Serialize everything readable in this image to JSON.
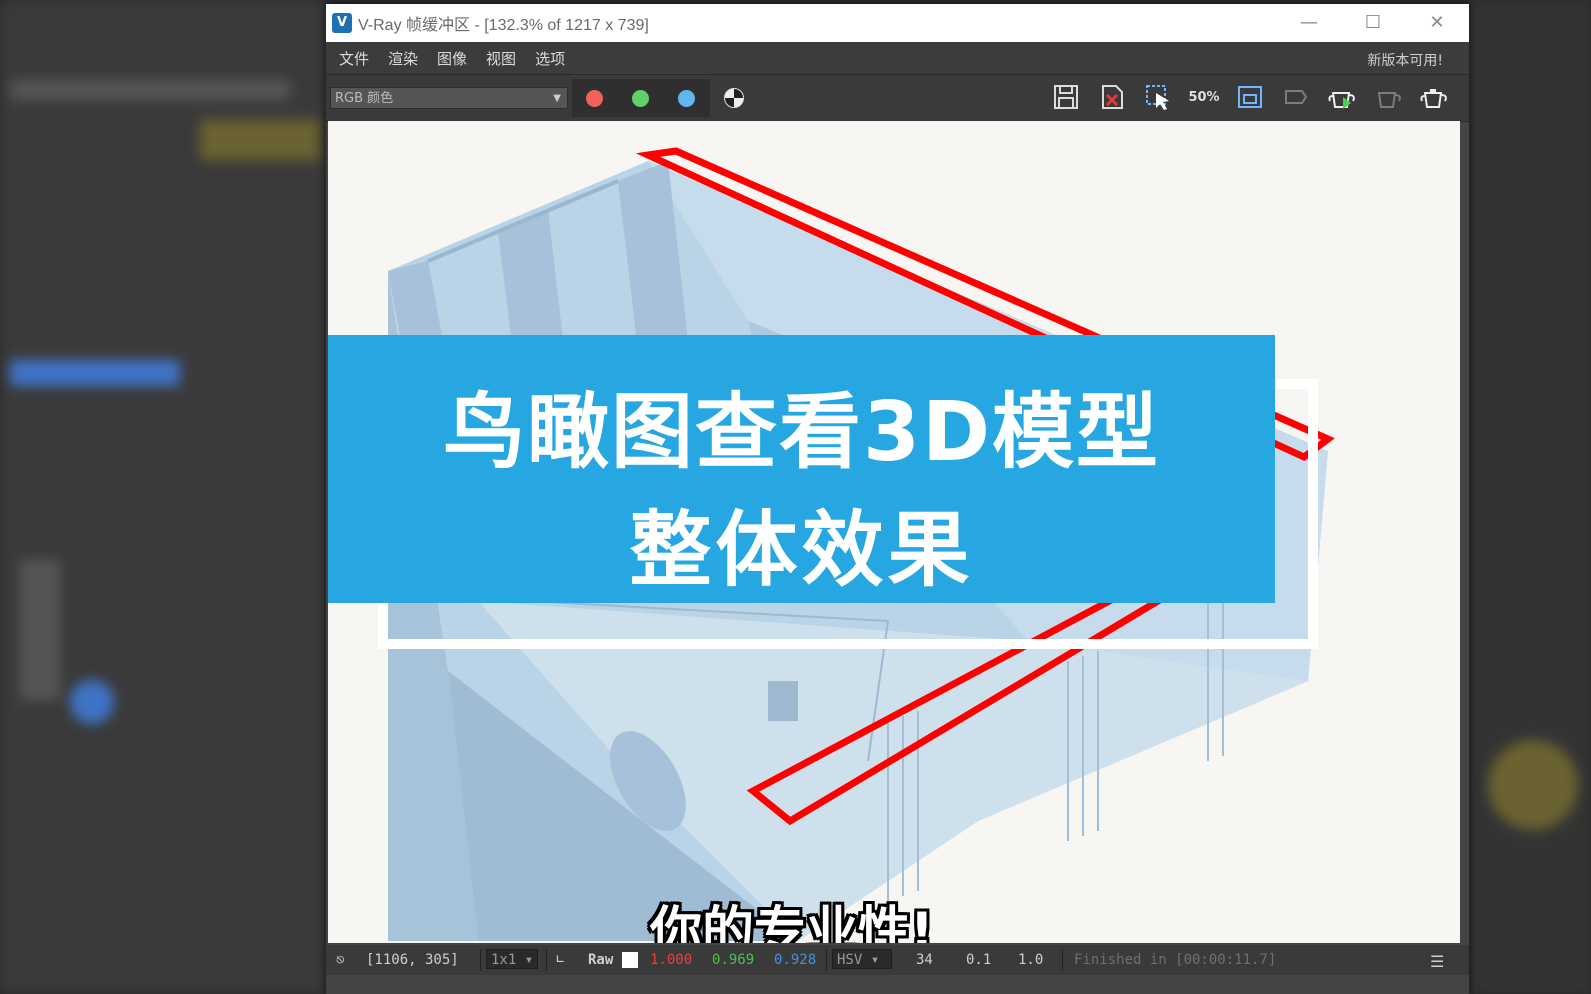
{
  "window": {
    "app_icon_letter": "V",
    "title": "V-Ray 帧缓冲区 - [132.3% of 1217 x 739]",
    "min_icon": "minimize-icon",
    "max_icon": "maximize-icon",
    "close_icon": "close-icon"
  },
  "menu": {
    "items": [
      "文件",
      "渲染",
      "图像",
      "视图",
      "选项"
    ],
    "update_note": "新版本可用!"
  },
  "toolbar": {
    "channel": "RGB 颜色",
    "channel_buttons": [
      {
        "name": "red-channel",
        "color": "#f0625a"
      },
      {
        "name": "green-channel",
        "color": "#5fd06a"
      },
      {
        "name": "blue-channel",
        "color": "#62b6ef"
      }
    ],
    "zoom_label": "50%",
    "tools": [
      "save-icon",
      "clear-icon",
      "region-select-icon",
      "zoom-50-icon",
      "track-mouse-icon",
      "link-icon",
      "render-teapot-icon",
      "stop-render-icon",
      "last-render-icon"
    ]
  },
  "overlay": {
    "banner_line1": "鸟瞰图查看3D模型",
    "banner_line2": "整体效果",
    "banner_color": "#26a7e1",
    "subtitle": "你的专业性!"
  },
  "status": {
    "coords": "[1106, 305]",
    "sampling": "1x1",
    "mode": "Raw",
    "r": "1.000",
    "g": "0.969",
    "b": "0.928",
    "color_space": "HSV",
    "v1": "34",
    "v2": "0.1",
    "v3": "1.0",
    "finished": "Finished in [00:00:11.7]",
    "r_color": "#e84040",
    "g_color": "#4ec04e",
    "b_color": "#4a8fe0"
  }
}
